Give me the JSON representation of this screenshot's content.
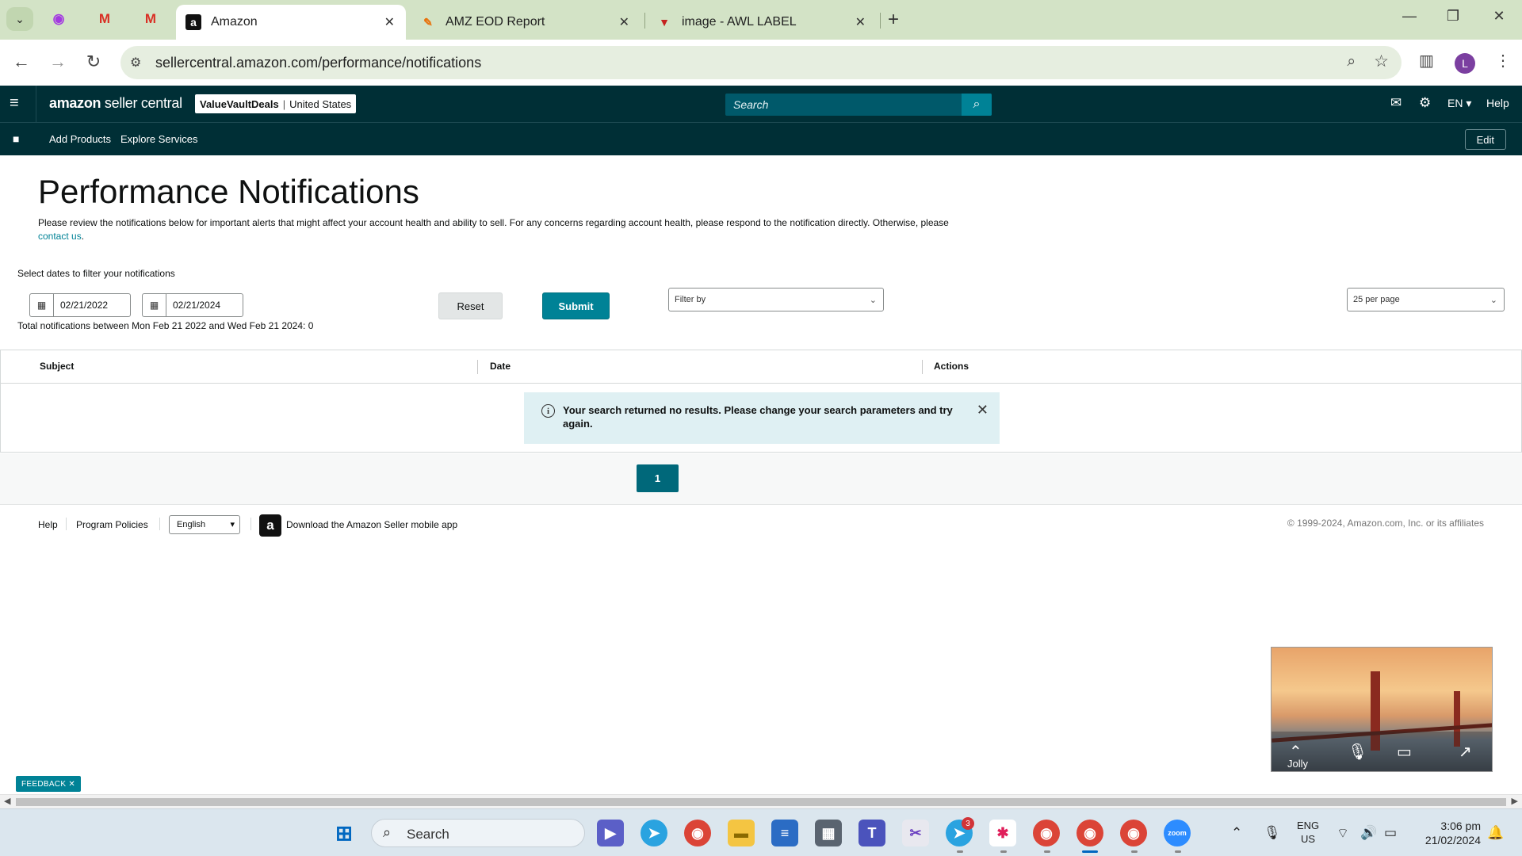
{
  "browser": {
    "tabs": [
      {
        "title": "Amazon",
        "active": true
      },
      {
        "title": "AMZ EOD Report",
        "active": false
      },
      {
        "title": "image - AWL LABEL",
        "active": false
      }
    ],
    "url": "sellercentral.amazon.com/performance/notifications",
    "profile_initial": "L"
  },
  "header": {
    "logo_brand": "amazon",
    "logo_product": "seller central",
    "store_name": "ValueVaultDeals",
    "marketplace": "United States",
    "search_placeholder": "Search",
    "language": "EN",
    "help": "Help"
  },
  "subnav": {
    "links": [
      "Add Products",
      "Explore Services"
    ],
    "edit": "Edit"
  },
  "page": {
    "title": "Performance Notifications",
    "intro": "Please review the notifications below for important alerts that might affect your account health and ability to sell. For any concerns regarding account health, please respond to the notification directly. Otherwise, please",
    "contact_link": "contact us",
    "filter_label": "Select dates to filter your notifications",
    "start_date": "02/21/2022",
    "end_date": "02/21/2024",
    "reset": "Reset",
    "submit": "Submit",
    "filter_by": "Filter by",
    "per_page": "25 per page",
    "total_text": "Total notifications between Mon Feb 21 2022 and Wed Feb 21 2024: 0",
    "columns": [
      "Subject",
      "Date",
      "Actions"
    ],
    "no_results": "Your search returned no results. Please change your search parameters and try again.",
    "current_page": "1"
  },
  "footer": {
    "help": "Help",
    "program_policies": "Program Policies",
    "language": "English",
    "app_download": "Download the Amazon Seller mobile app",
    "copyright": "© 1999-2024, Amazon.com, Inc. or its affiliates"
  },
  "video": {
    "participant": "Jolly"
  },
  "feedback": "FEEDBACK",
  "taskbar": {
    "search": "Search",
    "telegram_badge": "3",
    "lang_line1": "ENG",
    "lang_line2": "US",
    "time": "3:06 pm",
    "date": "21/02/2024"
  }
}
